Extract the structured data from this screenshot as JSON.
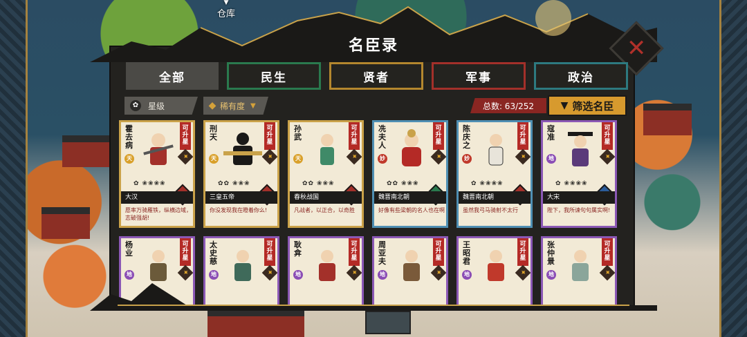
{
  "background": {
    "warehouse_label": "仓库"
  },
  "header": {
    "title": "名臣录",
    "close_icon": "close-x-icon"
  },
  "tabs": [
    {
      "label": "全部",
      "active": true,
      "color": "#4b4a46"
    },
    {
      "label": "民生",
      "active": false,
      "color": "#2a7a4e"
    },
    {
      "label": "贤者",
      "active": false,
      "color": "#b4872e"
    },
    {
      "label": "军事",
      "active": false,
      "color": "#a3302a"
    },
    {
      "label": "政治",
      "active": false,
      "color": "#2d7a80"
    }
  ],
  "filters": {
    "star_label": "星级",
    "rarity_label": "稀有度",
    "total": "总数: 63/252",
    "filter_button": "筛选名臣"
  },
  "cards": [
    {
      "name": "霍去病",
      "rank": "天",
      "upgrade": "可升星",
      "era": "大汉",
      "type": "军",
      "quote": "愿率万骑雁铁，纵横边域，志破强胡!"
    },
    {
      "name": "刑天",
      "rank": "天",
      "upgrade": "可升星",
      "era": "三皇五帝",
      "type": "军",
      "quote": "你没发现我在瞪着你么!"
    },
    {
      "name": "孙武",
      "rank": "天",
      "upgrade": "可升星",
      "era": "春秋战国",
      "type": "军",
      "quote": "凡战者，以正合，以奇胜"
    },
    {
      "name": "冼夫人",
      "rank": "妙",
      "upgrade": "可升星",
      "era": "魏晋南北朝",
      "type": "民",
      "quote": "好像有些梁朝的名人也在啊"
    },
    {
      "name": "陈庆之",
      "rank": "妙",
      "upgrade": "可升星",
      "era": "魏晋南北朝",
      "type": "军",
      "quote": "虽然我弓马骑射不太行"
    },
    {
      "name": "寇准",
      "rank": "地",
      "upgrade": "可升星",
      "era": "大宋",
      "type": "政",
      "quote": "陛下，我所谏句句属实啊!"
    },
    {
      "name": "杨业",
      "rank": "地",
      "upgrade": "可升星",
      "era": "",
      "type": "",
      "quote": ""
    },
    {
      "name": "太史慈",
      "rank": "地",
      "upgrade": "可升星",
      "era": "",
      "type": "",
      "quote": ""
    },
    {
      "name": "耿弇",
      "rank": "地",
      "upgrade": "可升星",
      "era": "",
      "type": "",
      "quote": ""
    },
    {
      "name": "周亚夫",
      "rank": "地",
      "upgrade": "可升星",
      "era": "",
      "type": "",
      "quote": ""
    },
    {
      "name": "王昭君",
      "rank": "地",
      "upgrade": "可升星",
      "era": "",
      "type": "",
      "quote": ""
    },
    {
      "name": "张仲景",
      "rank": "地",
      "upgrade": "可升星",
      "era": "",
      "type": "",
      "quote": ""
    }
  ]
}
